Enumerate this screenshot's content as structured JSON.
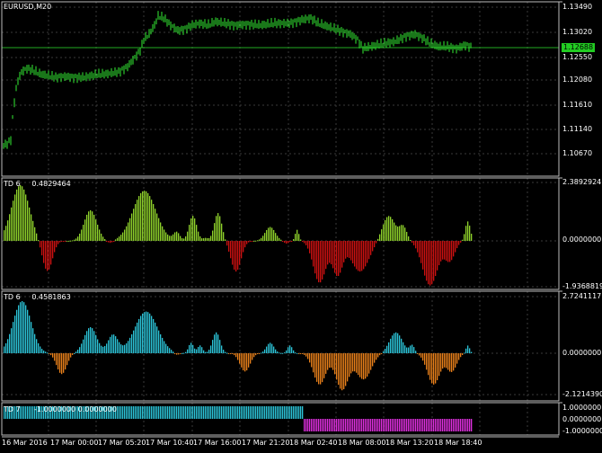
{
  "colors": {
    "background": "#000000",
    "grid": "#3a3a3a",
    "frame": "#bdbdbd",
    "candle": "#33ee33",
    "current_price_line": "#22aa22",
    "green_bar": "#8fd22b",
    "red_bar": "#cc1111",
    "cyan_bar": "#2cc4d8",
    "orange_bar": "#e8801a",
    "magenta_bar": "#e030e0"
  },
  "main_panel": {
    "symbol_label": "EURUSD,M20",
    "current_price": "1.12688",
    "y_axis_labels": [
      "1.13490",
      "1.13020",
      "1.12550",
      "1.12080",
      "1.11610",
      "1.11140",
      "1.10670"
    ]
  },
  "panel_td6_a": {
    "label": "TD 6",
    "value": "0.4829464",
    "y_axis_labels": [
      "2.3892924",
      "0.0000000",
      "-1.9368819"
    ]
  },
  "panel_td6_b": {
    "label": "TD 6",
    "value": "0.4581863",
    "y_axis_labels": [
      "2.7241117",
      "0.0000000",
      "-2.1214390"
    ]
  },
  "panel_td7": {
    "label": "TD 7",
    "value": "-1.0000000 0.0000000",
    "y_axis_labels": [
      "1.0000000",
      "0.0000000",
      "-1.0000000"
    ]
  },
  "time_axis_labels": [
    "16 Mar 2016",
    "17 Mar 00:00",
    "17 Mar 05:20",
    "17 Mar 10:40",
    "17 Mar 16:00",
    "17 Mar 21:20",
    "18 Mar 02:40",
    "18 Mar 08:00",
    "18 Mar 13:20",
    "18 Mar 18:40"
  ]
}
